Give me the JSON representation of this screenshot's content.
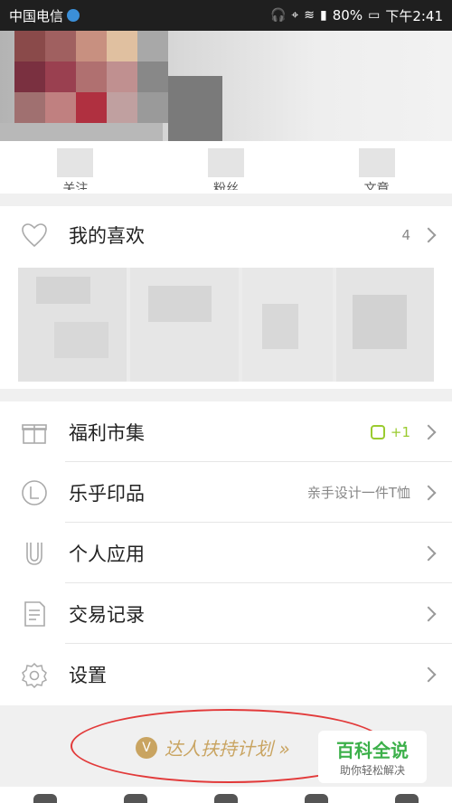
{
  "status_bar": {
    "carrier": "中国电信",
    "battery": "80%",
    "time": "下午2:41",
    "icons": [
      "headset-icon",
      "location-icon",
      "wifi-icon",
      "signal-icon",
      "battery-icon"
    ]
  },
  "profile": {
    "stats": [
      {
        "label": "关注"
      },
      {
        "label": "粉丝"
      },
      {
        "label": "文章"
      }
    ]
  },
  "favorites": {
    "title": "我的喜欢",
    "count": "4",
    "icon": "heart-icon"
  },
  "menu": [
    {
      "id": "welfare",
      "label": "福利市集",
      "icon": "gift-icon",
      "meta": "+1",
      "meta_icon": "coin-icon"
    },
    {
      "id": "print",
      "label": "乐乎印品",
      "icon": "print-icon",
      "meta": "亲手设计一件T恤"
    },
    {
      "id": "apps",
      "label": "个人应用",
      "icon": "magnet-icon",
      "meta": ""
    },
    {
      "id": "trades",
      "label": "交易记录",
      "icon": "record-icon",
      "meta": ""
    },
    {
      "id": "settings",
      "label": "设置",
      "icon": "gear-icon",
      "meta": ""
    }
  ],
  "promo": {
    "text": "达人扶持计划 »",
    "badge": "V"
  },
  "watermark": {
    "title": "百科全说",
    "subtitle": "助你轻松解决"
  },
  "colors": {
    "accent": "#9acb2f",
    "promo_gold": "#c9a461",
    "annotation_red": "#e23a3a",
    "watermark_green": "#3cb04a"
  }
}
